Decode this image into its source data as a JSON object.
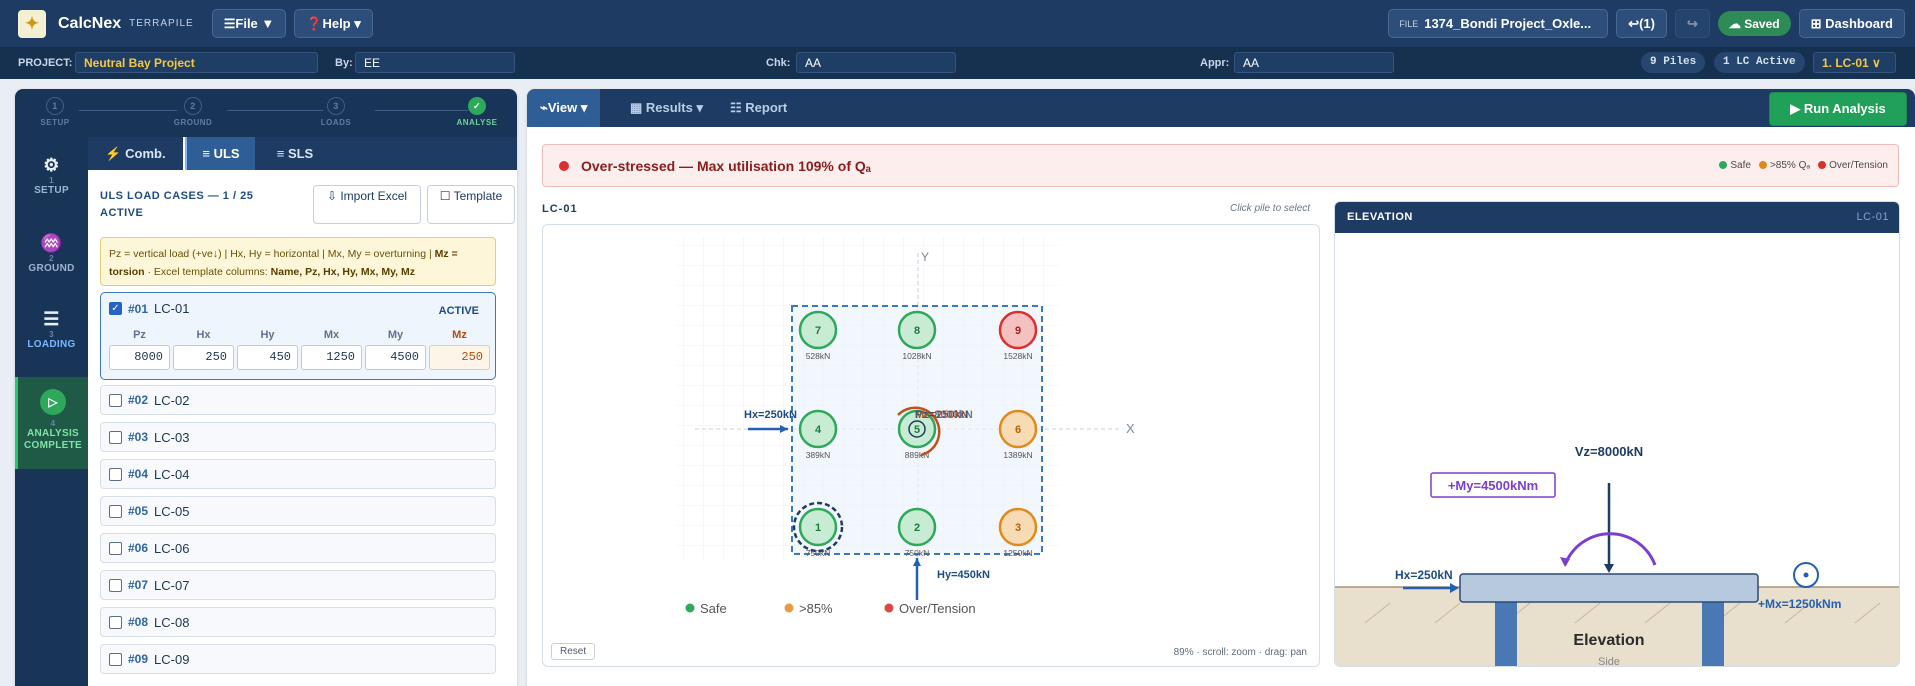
{
  "app": {
    "logo_glyph": "✦",
    "name": "CalcNex",
    "sub": "TERRAPILE",
    "file_menu": "☰File ▼",
    "help_menu": "❓Help ▾",
    "file_label": "FILE",
    "file_name": "1374_Bondi Project_Oxle...",
    "undo": "↩(1)",
    "redo": "↪",
    "saved": "☁ Saved",
    "dashboard": "⊞ Dashboard"
  },
  "project": {
    "project_label": "PROJECT:",
    "project": "Neutral Bay Project",
    "by_label": "By:",
    "by": "EE",
    "chk_label": "Chk:",
    "chk": "AA",
    "appr_label": "Appr:",
    "appr": "AA",
    "piles": "9 Piles",
    "lc_active": "1 LC Active",
    "lc_select": "1. LC-01 ∨"
  },
  "steps": [
    {
      "n": "1",
      "label": "SETUP"
    },
    {
      "n": "2",
      "label": "GROUND"
    },
    {
      "n": "3",
      "label": "LOADS"
    },
    {
      "n": "✓",
      "label": "ANALYSE"
    }
  ],
  "nav": [
    {
      "icon": "⚙",
      "n": "1",
      "label": "SETUP"
    },
    {
      "icon": "♒",
      "n": "2",
      "label": "GROUND"
    },
    {
      "icon": "☰",
      "n": "3",
      "label": "LOADING"
    },
    {
      "icon": "▷",
      "n": "4",
      "label": "ANALYSIS COMPLETE"
    }
  ],
  "comb_tabs": [
    "⚡ Comb.",
    "≡ ULS",
    "≡ SLS"
  ],
  "uls": {
    "title": "ULS LOAD CASES — 1 / 25 ACTIVE",
    "import": "⇩ Import Excel",
    "template": "☐ Template",
    "hint_a": "Pz = vertical load (+ve↓) | Hx, Hy = horizontal | Mx, My = overturning | ",
    "hint_b": "Mz = torsion",
    "hint_c": " · Excel template columns: ",
    "hint_d": "Name, Pz, Hx, Hy, Mx, My, Mz",
    "active_num": "#01",
    "active_name": "LC-01",
    "active_tag": "ACTIVE",
    "check": "✓",
    "cols": [
      "Pz",
      "Hx",
      "Hy",
      "Mx",
      "My",
      "Mz"
    ],
    "vals": [
      "8000",
      "250",
      "450",
      "1250",
      "4500",
      "250"
    ],
    "rows": [
      {
        "num": "#02",
        "name": "LC-02"
      },
      {
        "num": "#03",
        "name": "LC-03"
      },
      {
        "num": "#04",
        "name": "LC-04"
      },
      {
        "num": "#05",
        "name": "LC-05"
      },
      {
        "num": "#06",
        "name": "LC-06"
      },
      {
        "num": "#07",
        "name": "LC-07"
      },
      {
        "num": "#08",
        "name": "LC-08"
      },
      {
        "num": "#09",
        "name": "LC-09"
      }
    ]
  },
  "main": {
    "tabs": [
      "⌁View ▾",
      "▦ Results ▾",
      "☷ Report"
    ],
    "run": "▶ Run Analysis",
    "alert": "Over-stressed — Max utilisation 109% of Qₐ",
    "leg_safe": "Safe",
    "leg_85": ">85% Qₐ",
    "leg_over": "Over/Tension",
    "lc": "LC-01",
    "click_hint": "Click pile to select",
    "reset": "Reset",
    "zoom_info": "89% · scroll: zoom · drag: pan"
  },
  "plan": {
    "axis_x": "X",
    "axis_y": "Y",
    "hx": "Hx=250kN",
    "hy": "Hy=450kN",
    "pz": "Pz=8000kN",
    "mz": "Mz=250kN",
    "legend_safe": "Safe",
    "legend_85": ">85%",
    "legend_over": "Over/Tension",
    "piles": [
      {
        "id": "1",
        "load": "750kN",
        "state": "safe"
      },
      {
        "id": "2",
        "load": "750kN",
        "state": "safe"
      },
      {
        "id": "3",
        "load": "1250kN",
        "state": "warn"
      },
      {
        "id": "4",
        "load": "389kN",
        "state": "safe"
      },
      {
        "id": "5",
        "load": "889kN",
        "state": "safe"
      },
      {
        "id": "6",
        "load": "1389kN",
        "state": "warn"
      },
      {
        "id": "7",
        "load": "528kN",
        "state": "safe"
      },
      {
        "id": "8",
        "load": "1028kN",
        "state": "safe"
      },
      {
        "id": "9",
        "load": "1528kN",
        "state": "over"
      }
    ]
  },
  "elevation": {
    "title": "ELEVATION",
    "lc": "LC-01",
    "vz": "Vz=8000kN",
    "my": "+My=4500kNm",
    "hx": "Hx=250kN",
    "mx": "+Mx=1250kNm",
    "label": "Elevation",
    "sub": "Side"
  },
  "colors": {
    "safe": "#2ea85a",
    "warn": "#e08a1e",
    "over": "#d93030",
    "accent": "#2f5e96"
  }
}
